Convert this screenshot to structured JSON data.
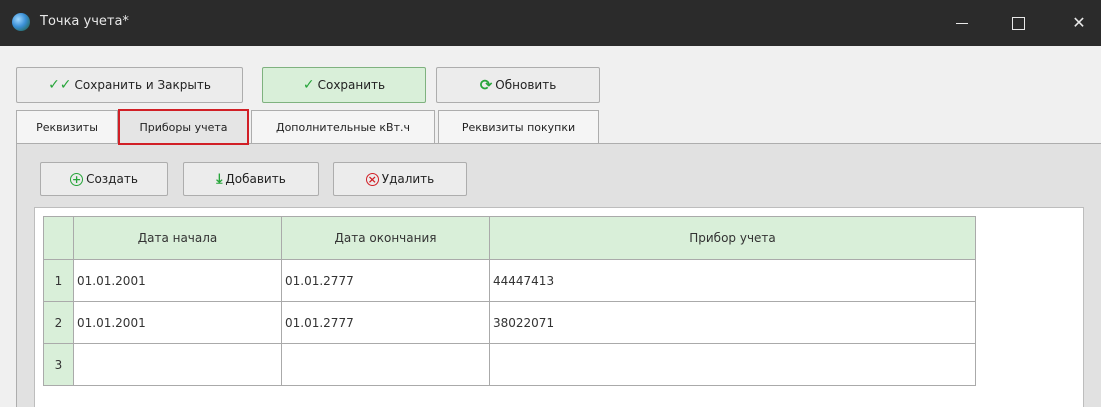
{
  "window": {
    "title": "Точка учета*",
    "controls": {
      "minimize": "",
      "maximize": "",
      "close": "✕"
    }
  },
  "toolbar": {
    "save_close_label": "Сохранить и Закрыть",
    "save_label": "Сохранить",
    "refresh_label": "Обновить"
  },
  "tabs": [
    {
      "label": "Реквизиты"
    },
    {
      "label": "Приборы учета"
    },
    {
      "label": "Дополнительные кВт.ч"
    },
    {
      "label": "Реквизиты покупки"
    }
  ],
  "selected_tab": "Приборы учета",
  "subtoolbar": {
    "create_label": "Создать",
    "add_label": "Добавить",
    "delete_label": "Удалить"
  },
  "grid": {
    "columns": [
      "Дата начала",
      "Дата окончания",
      "Прибор учета"
    ],
    "rows": [
      {
        "num": "1",
        "start": "01.01.2001",
        "end": "01.01.2777",
        "device": "44447413"
      },
      {
        "num": "2",
        "start": "01.01.2001",
        "end": "01.01.2777",
        "device": "38022071"
      },
      {
        "num": "3",
        "start": "",
        "end": "",
        "device": ""
      }
    ]
  },
  "colors": {
    "titlebar": "#2b2b2b",
    "header_green": "#d9efd9",
    "accent_green": "#27a53a",
    "highlight_red": "#d11f26"
  }
}
